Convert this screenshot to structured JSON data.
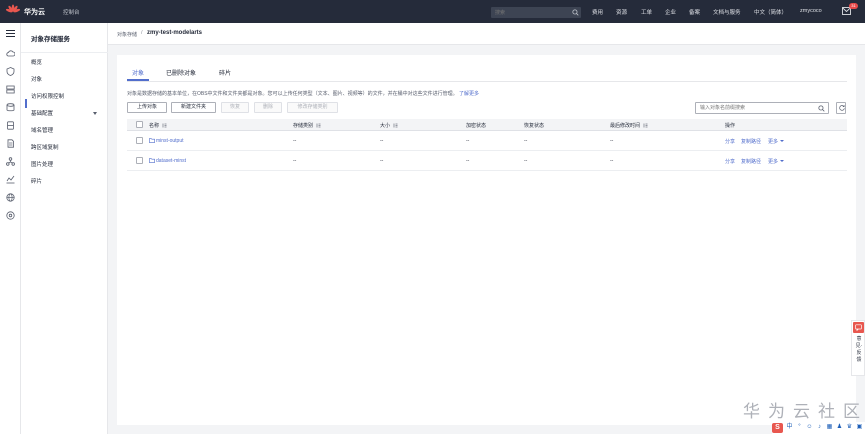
{
  "topbar": {
    "brand": "华为云",
    "console": "控制台",
    "search_placeholder": "搜索",
    "nav": [
      "费用",
      "资源",
      "工单",
      "企业",
      "备案",
      "文档与服务",
      "中文（简体）",
      "zmycoco"
    ],
    "mail_badge": "31"
  },
  "sidebar": {
    "title": "对象存储服务",
    "items": [
      {
        "label": "概览"
      },
      {
        "label": "对象"
      },
      {
        "label": "访问权限控制"
      },
      {
        "label": "基础配置"
      },
      {
        "label": "域名管理"
      },
      {
        "label": "跨区域复制"
      },
      {
        "label": "图片处理"
      },
      {
        "label": "碎片"
      }
    ]
  },
  "breadcrumb": {
    "parent": "对象存储",
    "separator": "/",
    "current": "zmy-test-modelarts"
  },
  "tabs": [
    "对象",
    "已删除对象",
    "碎片"
  ],
  "description": {
    "text": "对象是数据存储的基本单位，在OBS中文件和文件夹都是对象。您可以上传任何类型（文本、图片、视频等）的文件，并在桶中对这些文件进行管理。",
    "link": "了解更多"
  },
  "toolbar": {
    "upload": "上传对象",
    "new_folder": "新建文件夹",
    "restore": "恢复",
    "delete": "删除",
    "change_storage": "修改存储类别",
    "search_placeholder": "输入对象名前缀搜索"
  },
  "table": {
    "columns": [
      "名称",
      "存储类别",
      "大小",
      "加密状态",
      "恢复状态",
      "最后修改时间",
      "操作"
    ],
    "rows": [
      {
        "name": "minst-output",
        "storage": "--",
        "size": "--",
        "encryption": "--",
        "restore": "--",
        "modified": "--",
        "ops": [
          "分享",
          "复制路径",
          "更多"
        ]
      },
      {
        "name": "dataset-minst",
        "storage": "--",
        "size": "--",
        "encryption": "--",
        "restore": "--",
        "modified": "--",
        "ops": [
          "分享",
          "复制路径",
          "更多"
        ]
      }
    ]
  },
  "feedback": {
    "label": "意见·反馈"
  },
  "watermark": "华为云社区",
  "tray": {
    "logo": "S",
    "items": [
      "中",
      "°",
      "☺",
      "♪",
      "▦",
      "♟",
      "♛",
      "▣"
    ]
  },
  "colors": {
    "accent": "#526ecc",
    "topbar": "#252b3a",
    "brand_red": "#e8574f"
  }
}
